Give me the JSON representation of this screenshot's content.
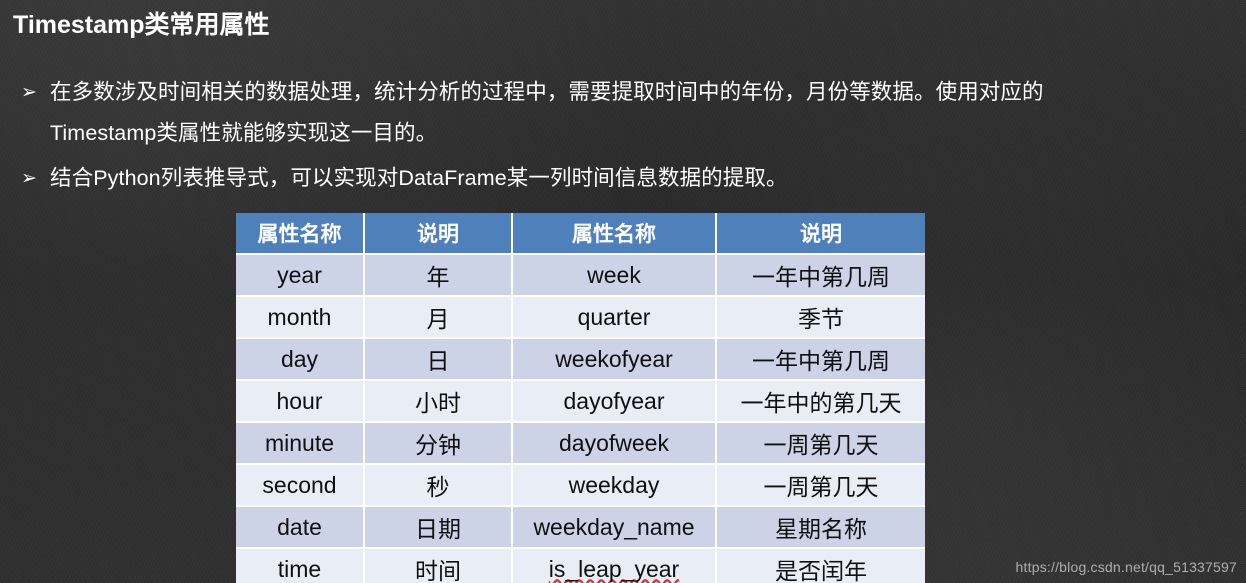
{
  "slide": {
    "title": "Timestamp类常用属性",
    "background_color": "#2d2d2d",
    "accent_color": "#4e81bc"
  },
  "bullets": [
    {
      "marker": "➢",
      "line1": "在多数涉及时间相关的数据处理，统计分析的过程中，需要提取时间中的年份，月份等数据。使用对应的",
      "line2": "Timestamp类属性就能够实现这一目的。"
    },
    {
      "marker": "➢",
      "line1": "结合Python列表推导式，可以实现对DataFrame某一列时间信息数据的提取。",
      "line2": ""
    }
  ],
  "table": {
    "headers": [
      "属性名称",
      "说明",
      "属性名称",
      "说明"
    ],
    "rows": [
      {
        "attr1": "year",
        "desc1": "年",
        "attr2": "week",
        "desc2": "一年中第几周",
        "band": "band-dark",
        "misspelled2": false
      },
      {
        "attr1": "month",
        "desc1": "月",
        "attr2": "quarter",
        "desc2": "季节",
        "band": "band-light",
        "misspelled2": false
      },
      {
        "attr1": "day",
        "desc1": "日",
        "attr2": "weekofyear",
        "desc2": "一年中第几周",
        "band": "band-dark",
        "misspelled2": false
      },
      {
        "attr1": "hour",
        "desc1": "小时",
        "attr2": "dayofyear",
        "desc2": "一年中的第几天",
        "band": "band-light",
        "misspelled2": false
      },
      {
        "attr1": "minute",
        "desc1": "分钟",
        "attr2": "dayofweek",
        "desc2": "一周第几天",
        "band": "band-dark",
        "misspelled2": false
      },
      {
        "attr1": "second",
        "desc1": "秒",
        "attr2": "weekday",
        "desc2": "一周第几天",
        "band": "band-light",
        "misspelled2": false
      },
      {
        "attr1": "date",
        "desc1": "日期",
        "attr2": "weekday_name",
        "desc2": "星期名称",
        "band": "band-dark",
        "misspelled2": false
      },
      {
        "attr1": "time",
        "desc1": "时间",
        "attr2": "is_leap_year",
        "desc2": "是否闰年",
        "band": "band-light",
        "misspelled2": true
      }
    ]
  },
  "watermark": {
    "text": "https://blog.csdn.net/qq_51337597"
  }
}
